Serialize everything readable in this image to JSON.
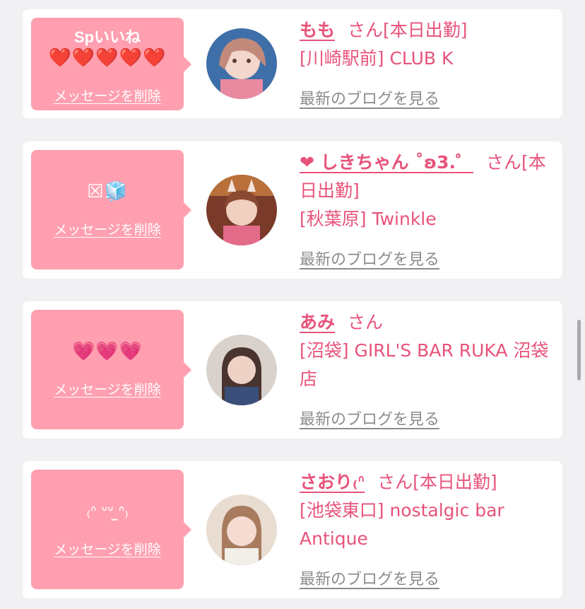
{
  "colors": {
    "page_bg": "#f1f1f3",
    "card_bg": "#ffffff",
    "bubble_bg": "#ff9fb0",
    "accent_pink": "#e8537a",
    "link_gray": "#8c8c8c"
  },
  "cards": [
    {
      "message_title": "Spいいね",
      "message": "❤️❤️❤️❤️❤️",
      "delete_label": "メッセージを削除",
      "name": "もも",
      "suffix": "さん[本日出勤]",
      "shop": "[川崎駅前] CLUB K",
      "blog_label": "最新のブログを見る",
      "avatar_icon": "avatar-photo"
    },
    {
      "message": "☒🧊",
      "delete_label": "メッセージを削除",
      "name": "❤︎ しきちゃん ˚ʚ3.゜",
      "suffix": "さん[本日出勤]",
      "shop": "[秋葉原] Twinkle",
      "blog_label": "最新のブログを見る",
      "avatar_icon": "avatar-photo"
    },
    {
      "message": "💗💗💗",
      "delete_label": "メッセージを削除",
      "name": "あみ",
      "suffix": "さん",
      "shop": "[沼袋] GIRL'S BAR RUKA 沼袋店",
      "blog_label": "最新のブログを見る",
      "avatar_icon": "avatar-photo"
    },
    {
      "message": "₍ᐢ ᐡᐡ ̫ᐢ₎",
      "delete_label": "メッセージを削除",
      "name": "さおり₍ᐢ",
      "suffix": "さん[本日出勤]",
      "shop": "[池袋東口] nostalgic bar Antique",
      "blog_label": "最新のブログを見る",
      "avatar_icon": "avatar-photo"
    }
  ]
}
